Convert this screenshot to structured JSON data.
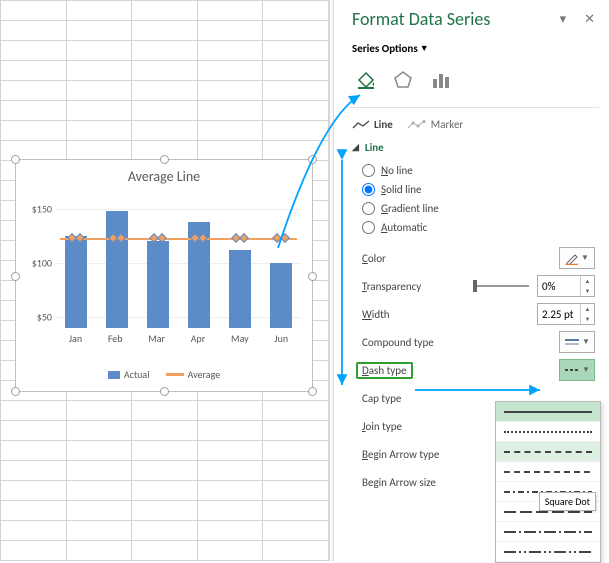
{
  "pane": {
    "title": "Format Data Series",
    "series_options_label": "Series Options",
    "tabs": {
      "line": "Line",
      "marker": "Marker"
    },
    "section": "Line",
    "radios": {
      "no_line": "o line",
      "solid": "olid line",
      "gradient": "radient line",
      "automatic": "utomatic"
    },
    "props": {
      "color": "olor",
      "transparency": "ransparency",
      "width": "idth",
      "compound": "Compound type",
      "dash": "ash type",
      "cap": "Cap type",
      "join": "oin type",
      "begin_arrow_type": "egin Arrow type",
      "begin_arrow_size": "egin Arrow size"
    },
    "values": {
      "transparency": "0%",
      "width": "2.25 pt"
    },
    "tooltip": "Square Dot"
  },
  "chart_data": {
    "type": "bar+line",
    "title": "Average Line",
    "categories": [
      "Jan",
      "Feb",
      "Mar",
      "Apr",
      "May",
      "Jun"
    ],
    "series": [
      {
        "name": "Actual",
        "type": "bar",
        "values": [
          125,
          148,
          120,
          138,
          112,
          100
        ]
      },
      {
        "name": "Average",
        "type": "line",
        "values": [
          123,
          123,
          123,
          123,
          123,
          123
        ]
      }
    ],
    "yticks": [
      50,
      100,
      150
    ],
    "ylim": [
      40,
      160
    ],
    "ylabel_prefix": "$"
  },
  "legend": {
    "actual": "Actual",
    "average": "Average"
  }
}
